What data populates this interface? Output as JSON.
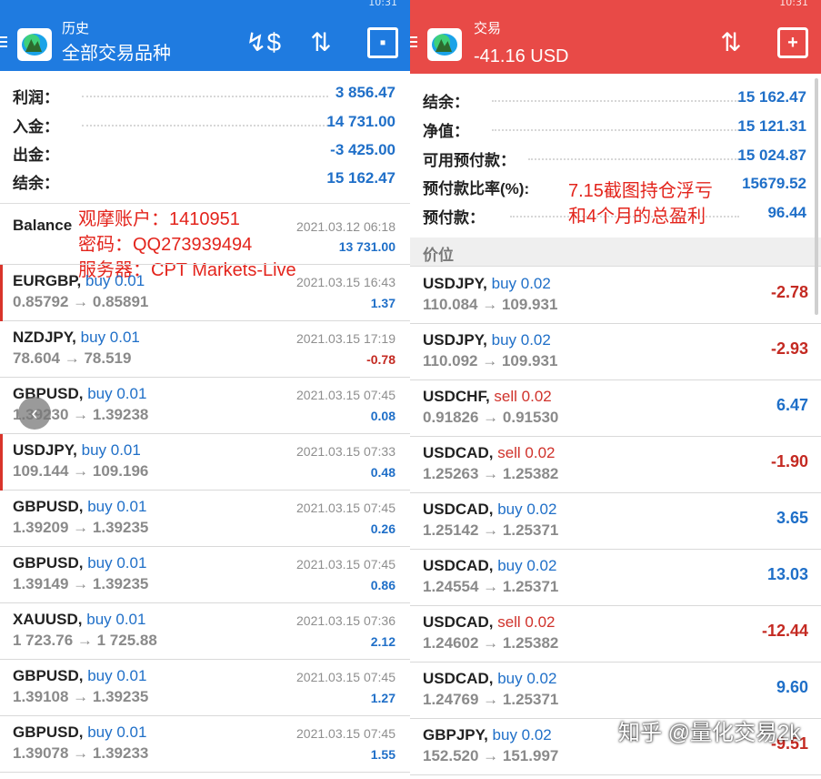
{
  "colors": {
    "left_appbar": "#1f7be0",
    "right_appbar": "#e84a47",
    "positive": "#1f6fc8",
    "negative": "#c42a22",
    "annotation": "#e3241c"
  },
  "left": {
    "appbar": {
      "title": "历史",
      "subtitle": "全部交易品种",
      "icons": [
        "currency-exchange-icon",
        "sort-icon",
        "calendar-icon"
      ]
    },
    "summary": [
      {
        "label": "利润：",
        "value": "3 856.47"
      },
      {
        "label": "入金：",
        "value": "14 731.00"
      },
      {
        "label": "出金：",
        "value": "-3 425.00"
      },
      {
        "label": "结余：",
        "value": "15 162.47"
      }
    ],
    "annotation": [
      "观摩账户：1410951",
      "密码：QQ273939494",
      "服务器：CPT Markets-Live"
    ],
    "balance": {
      "label": "Balance",
      "time": "2021.03.12 06:18",
      "amount": "13 731.00"
    },
    "deals": [
      {
        "symbol": "EURGBP,",
        "action": "buy 0.01",
        "type": "buy",
        "prices": "0.85792 → 0.85891",
        "time": "2021.03.15 16:43",
        "pl": "1.37",
        "sign": "pos",
        "marked": true
      },
      {
        "symbol": "NZDJPY,",
        "action": "buy 0.01",
        "type": "buy",
        "prices": "78.604 → 78.519",
        "time": "2021.03.15 17:19",
        "pl": "-0.78",
        "sign": "neg",
        "marked": false
      },
      {
        "symbol": "GBPUSD,",
        "action": "buy 0.01",
        "type": "buy",
        "prices": "1.39230 → 1.39238",
        "time": "2021.03.15 07:45",
        "pl": "0.08",
        "sign": "pos",
        "marked": false
      },
      {
        "symbol": "USDJPY,",
        "action": "buy 0.01",
        "type": "buy",
        "prices": "109.144 → 109.196",
        "time": "2021.03.15 07:33",
        "pl": "0.48",
        "sign": "pos",
        "marked": true
      },
      {
        "symbol": "GBPUSD,",
        "action": "buy 0.01",
        "type": "buy",
        "prices": "1.39209 → 1.39235",
        "time": "2021.03.15 07:45",
        "pl": "0.26",
        "sign": "pos",
        "marked": false
      },
      {
        "symbol": "GBPUSD,",
        "action": "buy 0.01",
        "type": "buy",
        "prices": "1.39149 → 1.39235",
        "time": "2021.03.15 07:45",
        "pl": "0.86",
        "sign": "pos",
        "marked": false
      },
      {
        "symbol": "XAUUSD,",
        "action": "buy 0.01",
        "type": "buy",
        "prices": "1 723.76 → 1 725.88",
        "time": "2021.03.15 07:36",
        "pl": "2.12",
        "sign": "pos",
        "marked": false
      },
      {
        "symbol": "GBPUSD,",
        "action": "buy 0.01",
        "type": "buy",
        "prices": "1.39108 → 1.39235",
        "time": "2021.03.15 07:45",
        "pl": "1.27",
        "sign": "pos",
        "marked": false
      },
      {
        "symbol": "GBPUSD,",
        "action": "buy 0.01",
        "type": "buy",
        "prices": "1.39078 → 1.39233",
        "time": "2021.03.15 07:45",
        "pl": "1.55",
        "sign": "pos",
        "marked": false
      }
    ],
    "status_time": "10:31"
  },
  "right": {
    "appbar": {
      "title": "交易",
      "subtitle": "-41.16 USD",
      "icons": [
        "sort-icon",
        "new-order-icon"
      ]
    },
    "summary": [
      {
        "label": "结余：",
        "value": "15 162.47"
      },
      {
        "label": "净值：",
        "value": "15 121.31"
      },
      {
        "label": "可用预付款：",
        "value": "15 024.87"
      },
      {
        "label": "预付款比率(%):",
        "value": "15679.52"
      },
      {
        "label": "预付款：",
        "value": "96.44"
      }
    ],
    "annotation": [
      "7.15截图持仓浮亏",
      "和4个月的总盈利"
    ],
    "section": "价位",
    "positions": [
      {
        "symbol": "USDJPY,",
        "action": "buy 0.02",
        "type": "buy",
        "prices": "110.084 → 109.931",
        "pl": "-2.78",
        "sign": "neg"
      },
      {
        "symbol": "USDJPY,",
        "action": "buy 0.02",
        "type": "buy",
        "prices": "110.092 → 109.931",
        "pl": "-2.93",
        "sign": "neg"
      },
      {
        "symbol": "USDCHF,",
        "action": "sell 0.02",
        "type": "sell",
        "prices": "0.91826 → 0.91530",
        "pl": "6.47",
        "sign": "pos"
      },
      {
        "symbol": "USDCAD,",
        "action": "sell 0.02",
        "type": "sell",
        "prices": "1.25263 → 1.25382",
        "pl": "-1.90",
        "sign": "neg"
      },
      {
        "symbol": "USDCAD,",
        "action": "buy 0.02",
        "type": "buy",
        "prices": "1.25142 → 1.25371",
        "pl": "3.65",
        "sign": "pos"
      },
      {
        "symbol": "USDCAD,",
        "action": "buy 0.02",
        "type": "buy",
        "prices": "1.24554 → 1.25371",
        "pl": "13.03",
        "sign": "pos"
      },
      {
        "symbol": "USDCAD,",
        "action": "sell 0.02",
        "type": "sell",
        "prices": "1.24602 → 1.25382",
        "pl": "-12.44",
        "sign": "neg"
      },
      {
        "symbol": "USDCAD,",
        "action": "buy 0.02",
        "type": "buy",
        "prices": "1.24769 → 1.25371",
        "pl": "9.60",
        "sign": "pos"
      },
      {
        "symbol": "GBPJPY,",
        "action": "buy 0.02",
        "type": "buy",
        "prices": "152.520 → 151.997",
        "pl": "-9.51",
        "sign": "neg"
      }
    ],
    "status_time": "10:31"
  },
  "watermark": "知乎 @量化交易2k"
}
